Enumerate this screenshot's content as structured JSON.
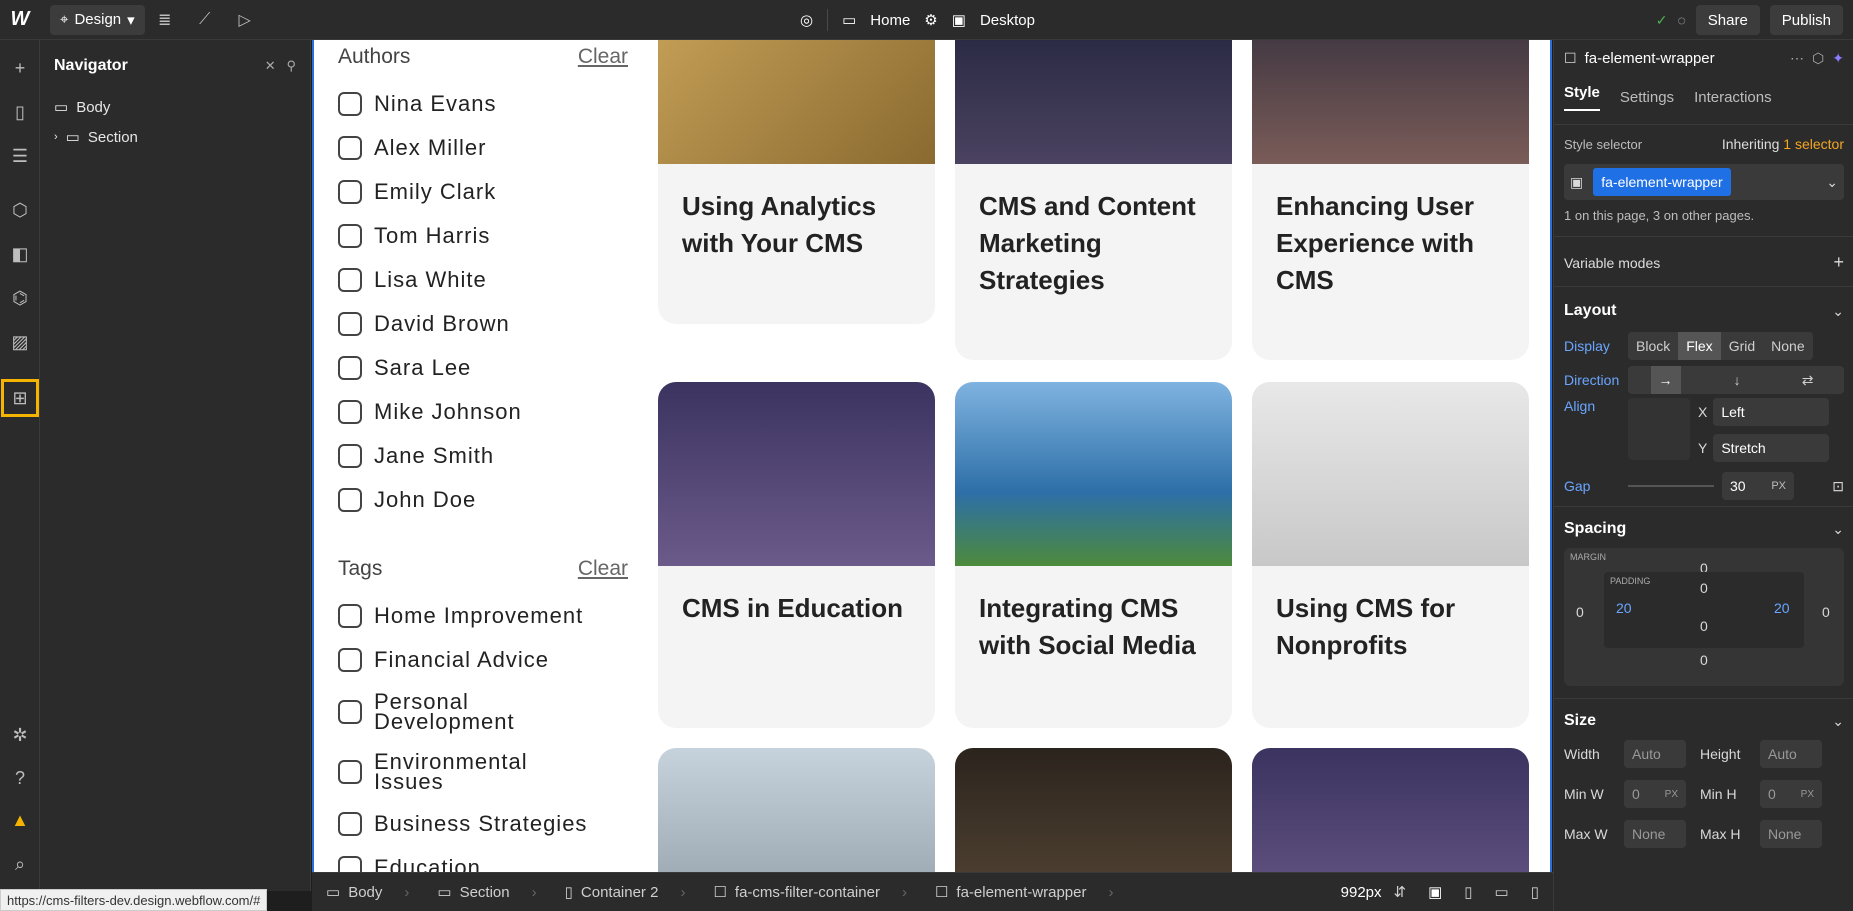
{
  "topbar": {
    "mode": "Design",
    "page": "Home",
    "breakpoint": "Desktop",
    "share": "Share",
    "publish": "Publish"
  },
  "navigator": {
    "title": "Navigator",
    "items": [
      "Body",
      "Section"
    ]
  },
  "filters": {
    "authors": {
      "title": "Authors",
      "clear": "Clear",
      "items": [
        "Nina Evans",
        "Alex Miller",
        "Emily Clark",
        "Tom Harris",
        "Lisa White",
        "David Brown",
        "Sara Lee",
        "Mike Johnson",
        "Jane Smith",
        "John Doe"
      ]
    },
    "tags": {
      "title": "Tags",
      "clear": "Clear",
      "items": [
        "Home Improvement",
        "Financial Advice",
        "Personal Development",
        "Environmental Issues",
        "Business Strategies",
        "Education"
      ]
    }
  },
  "cards": [
    {
      "title": "Using Analytics with Your CMS",
      "color": "#b48a3c"
    },
    {
      "title": "CMS and Content Marketing Strategies",
      "color": "#3a3550"
    },
    {
      "title": "Enhancing User Experience with CMS",
      "color": "#5a4a5c"
    },
    {
      "title": "CMS in Education",
      "color": "#4b3f6b"
    },
    {
      "title": "Integrating CMS with Social Media",
      "color": "#3d7fb3"
    },
    {
      "title": "Using CMS for Nonprofits",
      "color": "#d8d8d8"
    },
    {
      "title": "",
      "color": "#8a9aa8"
    },
    {
      "title": "",
      "color": "#3b3228"
    },
    {
      "title": "",
      "color": "#4b3f6b"
    }
  ],
  "right": {
    "element": "fa-element-wrapper",
    "tabs": [
      "Style",
      "Settings",
      "Interactions"
    ],
    "style_selector_label": "Style selector",
    "inheriting": "Inheriting",
    "inheriting_count": "1 selector",
    "selector": "fa-element-wrapper",
    "usage": "1 on this page, 3 on other pages.",
    "variable_modes": "Variable modes",
    "layout": "Layout",
    "display_label": "Display",
    "display_opts": [
      "Block",
      "Flex",
      "Grid",
      "None"
    ],
    "direction_label": "Direction",
    "align_label": "Align",
    "x_label": "X",
    "x_val": "Left",
    "y_label": "Y",
    "y_val": "Stretch",
    "gap_label": "Gap",
    "gap_val": "30",
    "gap_unit": "PX",
    "spacing": "Spacing",
    "margin_label": "MARGIN",
    "padding_label": "PADDING",
    "margin": [
      "0",
      "0",
      "0",
      "0"
    ],
    "padding": [
      "0",
      "20",
      "0",
      "20"
    ],
    "size": "Size",
    "width_label": "Width",
    "width_val": "Auto",
    "height_label": "Height",
    "height_val": "Auto",
    "minw_label": "Min W",
    "minw_val": "0",
    "minh_label": "Min H",
    "minh_val": "0",
    "px": "PX",
    "maxw_label": "Max W",
    "maxw_val": "None",
    "maxh_label": "Max H",
    "maxh_val": "None"
  },
  "breadcrumbs": [
    "Body",
    "Section",
    "Container 2",
    "fa-cms-filter-container",
    "fa-element-wrapper"
  ],
  "viewport": "992px",
  "status_url": "https://cms-filters-dev.design.webflow.com/#"
}
